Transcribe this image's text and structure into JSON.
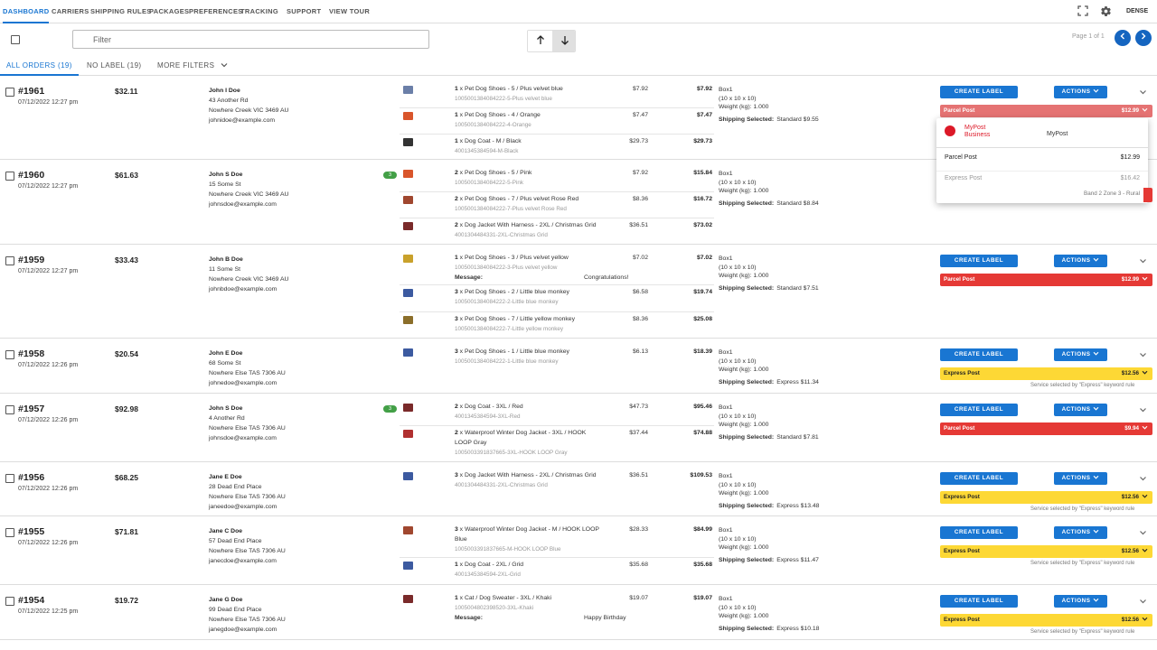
{
  "nav": {
    "items": [
      {
        "label": "Dashboard",
        "active": true
      },
      {
        "label": "Carriers"
      },
      {
        "label": "Shipping Rules"
      },
      {
        "label": "Packages"
      },
      {
        "label": "Preferences"
      },
      {
        "label": "Tracking"
      },
      {
        "label": "Support"
      },
      {
        "label": "View Tour"
      }
    ],
    "icons": [
      "fullscreen-icon",
      "gear-icon"
    ],
    "density_label": "DENSE"
  },
  "filter": {
    "placeholder": "Filter",
    "value": ""
  },
  "pager": {
    "label": "Page 1 of 1"
  },
  "tabs": [
    {
      "label": "All Orders (19)",
      "active": true
    },
    {
      "label": "No Label (19)"
    },
    {
      "label": "More Filters"
    }
  ],
  "button_labels": {
    "create": "CREATE LABEL",
    "actions": "ACTIONS"
  },
  "colors": {
    "primary": "#1976d2",
    "parcel_post": "#e53935",
    "express_post": "#fdd835",
    "qty_badge": "#43a047"
  },
  "orders": [
    {
      "number": "#1961",
      "date": "07/12/2022 12:27 pm",
      "total": "$32.11",
      "customer": {
        "name": "John I Doe",
        "street": "43 Another Rd",
        "city": "Nowhere Creek VIC 3469 AU",
        "email": "johnidoe@example.com"
      },
      "qty_badge": "",
      "items": [
        {
          "qty": "1",
          "title": " x Pet Dog Shoes - 5 / Plus velvet blue",
          "sku": "1005001384084222-5-Plus velvet blue",
          "unit": "$7.92",
          "line": "$7.92"
        },
        {
          "qty": "1",
          "title": " x Pet Dog Shoes - 4 / Orange",
          "sku": "1005001384084222-4-Orange",
          "unit": "$7.47",
          "line": "$7.47"
        },
        {
          "qty": "1",
          "title": " x Dog Coat - M / Black",
          "sku": "4001345384594-M-Black",
          "unit": "$29.73",
          "line": "$29.73"
        }
      ],
      "package": {
        "name": "Box1",
        "dims": "(10 x 10 x 10)",
        "weight": "Weight (kg): 1.000"
      },
      "shipping": {
        "label": "Shipping Selected:",
        "value": "Standard $9.55"
      },
      "service": {
        "name": "Parcel Post",
        "price": "$12.99",
        "note": ""
      }
    },
    {
      "number": "#1960",
      "date": "07/12/2022 12:27 pm",
      "total": "$61.63",
      "customer": {
        "name": "John S Doe",
        "street": "15 Some St",
        "city": "Nowhere Creek VIC 3469 AU",
        "email": "johnsdoe@example.com"
      },
      "qty_badge": "3",
      "items": [
        {
          "qty": "2",
          "title": " x Pet Dog Shoes - 5 / Pink",
          "sku": "1005001384084222-5-Pink",
          "unit": "$7.92",
          "line": "$15.84"
        },
        {
          "qty": "2",
          "title": " x Pet Dog Shoes - 7 / Plus velvet Rose Red",
          "sku": "1005001384084222-7-Plus velvet Rose Red",
          "unit": "$8.36",
          "line": "$16.72"
        },
        {
          "qty": "2",
          "title": " x Dog Jacket With Harness - 2XL / Christmas Grid",
          "sku": "4001304484331-2XL-Christmas Grid",
          "unit": "$36.51",
          "line": "$73.02"
        }
      ],
      "package": {
        "name": "Box1",
        "dims": "(10 x 10 x 10)",
        "weight": "Weight (kg): 1.000"
      },
      "shipping": {
        "label": "Shipping Selected:",
        "value": "Standard $8.84"
      },
      "service": {
        "name": "",
        "price": "",
        "note": ""
      }
    },
    {
      "number": "#1959",
      "date": "07/12/2022 12:27 pm",
      "total": "$33.43",
      "customer": {
        "name": "John B Doe",
        "street": "11 Some St",
        "city": "Nowhere Creek VIC 3469 AU",
        "email": "johnbdoe@example.com"
      },
      "qty_badge": "",
      "items": [
        {
          "qty": "1",
          "title": " x Pet Dog Shoes - 3 / Plus velvet yellow",
          "sku": "1005001384084222-3-Plus velvet yellow",
          "unit": "$7.02",
          "line": "$7.02",
          "message_label": "Message:",
          "message": "Congratulations!"
        },
        {
          "qty": "3",
          "title": " x Pet Dog Shoes - 2 / Little blue monkey",
          "sku": "1005001384084222-2-Little blue monkey",
          "unit": "$6.58",
          "line": "$19.74"
        },
        {
          "qty": "3",
          "title": " x Pet Dog Shoes - 7 / Little yellow monkey",
          "sku": "1005001384084222-7-Little yellow monkey",
          "unit": "$8.36",
          "line": "$25.08"
        }
      ],
      "package": {
        "name": "Box1",
        "dims": "(10 x 10 x 10)",
        "weight": "Weight (kg): 1.000"
      },
      "shipping": {
        "label": "Shipping Selected:",
        "value": "Standard $7.51"
      },
      "service": {
        "name": "Parcel Post",
        "price": "$12.99",
        "note": ""
      }
    },
    {
      "number": "#1958",
      "date": "07/12/2022 12:26 pm",
      "total": "$20.54",
      "customer": {
        "name": "John E Doe",
        "street": "68 Some St",
        "city": "Nowhere Else TAS 7306 AU",
        "email": "johnedoe@example.com"
      },
      "qty_badge": "",
      "items": [
        {
          "qty": "3",
          "title": " x Pet Dog Shoes - 1 / Little blue monkey",
          "sku": "1005001384084222-1-Little blue monkey",
          "unit": "$6.13",
          "line": "$18.39"
        }
      ],
      "package": {
        "name": "Box1",
        "dims": "(10 x 10 x 10)",
        "weight": "Weight (kg): 1.000"
      },
      "shipping": {
        "label": "Shipping Selected:",
        "value": "Express $11.34"
      },
      "service": {
        "name": "Express Post",
        "price": "$12.56",
        "note": "Service selected by \"Express\" keyword rule"
      }
    },
    {
      "number": "#1957",
      "date": "07/12/2022 12:26 pm",
      "total": "$92.98",
      "customer": {
        "name": "John S Doe",
        "street": "4 Another Rd",
        "city": "Nowhere Else TAS 7306 AU",
        "email": "johnsdoe@example.com"
      },
      "qty_badge": "3",
      "items": [
        {
          "qty": "2",
          "title": " x Dog Coat - 3XL / Red",
          "sku": "4001345384594-3XL-Red",
          "unit": "$47.73",
          "line": "$95.46"
        },
        {
          "qty": "2",
          "title": " x Waterproof Winter Dog Jacket - 3XL / HOOK",
          "title2": "LOOP Gray",
          "sku": "1005003391837665-3XL-HOOK LOOP Gray",
          "unit": "$37.44",
          "line": "$74.88"
        }
      ],
      "package": {
        "name": "Box1",
        "dims": "(10 x 10 x 10)",
        "weight": "Weight (kg): 1.000"
      },
      "shipping": {
        "label": "Shipping Selected:",
        "value": "Standard $7.81"
      },
      "service": {
        "name": "Parcel Post",
        "price": "$9.94",
        "note": ""
      }
    },
    {
      "number": "#1956",
      "date": "07/12/2022 12:26 pm",
      "total": "$68.25",
      "customer": {
        "name": "Jane E Doe",
        "street": "28 Dead End Place",
        "city": "Nowhere Else TAS 7306 AU",
        "email": "janeedoe@example.com"
      },
      "qty_badge": "",
      "items": [
        {
          "qty": "3",
          "title": " x Dog Jacket With Harness - 2XL / Christmas Grid",
          "sku": "4001304484331-2XL-Christmas Grid",
          "unit": "$36.51",
          "line": "$109.53"
        }
      ],
      "package": {
        "name": "Box1",
        "dims": "(10 x 10 x 10)",
        "weight": "Weight (kg): 1.000"
      },
      "shipping": {
        "label": "Shipping Selected:",
        "value": "Express $13.48"
      },
      "service": {
        "name": "Express Post",
        "price": "$12.56",
        "note": "Service selected by \"Express\" keyword rule"
      }
    },
    {
      "number": "#1955",
      "date": "07/12/2022 12:26 pm",
      "total": "$71.81",
      "customer": {
        "name": "Jane C Doe",
        "street": "57 Dead End Place",
        "city": "Nowhere Else TAS 7306 AU",
        "email": "janecdoe@example.com"
      },
      "qty_badge": "",
      "items": [
        {
          "qty": "3",
          "title": " x Waterproof Winter Dog Jacket - M / HOOK LOOP",
          "title2": "Blue",
          "sku": "1005003391837665-M-HOOK LOOP Blue",
          "unit": "$28.33",
          "line": "$84.99"
        },
        {
          "qty": "1",
          "title": " x Dog Coat - 2XL / Grid",
          "sku": "4001345384594-2XL-Grid",
          "unit": "$35.68",
          "line": "$35.68"
        }
      ],
      "package": {
        "name": "Box1",
        "dims": "(10 x 10 x 10)",
        "weight": "Weight (kg): 1.000"
      },
      "shipping": {
        "label": "Shipping Selected:",
        "value": "Express $11.47"
      },
      "service": {
        "name": "Express Post",
        "price": "$12.56",
        "note": "Service selected by \"Express\" keyword rule"
      }
    },
    {
      "number": "#1954",
      "date": "07/12/2022 12:25 pm",
      "total": "$19.72",
      "customer": {
        "name": "Jane G Doe",
        "street": "99 Dead End Place",
        "city": "Nowhere Else TAS 7306 AU",
        "email": "janegdoe@example.com"
      },
      "qty_badge": "",
      "items": [
        {
          "qty": "1",
          "title": " x Cat / Dog Sweater - 3XL / Khaki",
          "sku": "1005004802398520-3XL-Khaki",
          "unit": "$19.07",
          "line": "$19.07",
          "message_label": "Message:",
          "message": "Happy Birthday"
        }
      ],
      "package": {
        "name": "Box1",
        "dims": "(10 x 10 x 10)",
        "weight": "Weight (kg): 1.000"
      },
      "shipping": {
        "label": "Shipping Selected:",
        "value": "Express $10.18"
      },
      "service": {
        "name": "Express Post",
        "price": "$12.56",
        "note": "Service selected by \"Express\" keyword rule"
      }
    }
  ],
  "dropdown": {
    "brand_line1": "MyPost",
    "brand_line2": "Business",
    "carrier": "MyPost",
    "options": [
      {
        "name": "Parcel Post",
        "price": "$12.99"
      },
      {
        "name": "Express Post",
        "price": "$16.42"
      }
    ],
    "zone": "Band 2 Zone 3 - Rural"
  }
}
